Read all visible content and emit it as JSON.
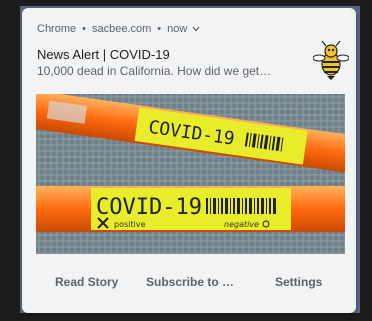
{
  "notification": {
    "app_name": "Chrome",
    "site": "sacbee.com",
    "time": "now",
    "separator": "•",
    "expand_icon": "chevron-down-icon",
    "title": "News Alert | COVID-19",
    "message": "10,000 dead in California. How did we get…",
    "logo_icon": "hornet-mascot-icon",
    "image": {
      "tube_label": "COVID-19",
      "positive_label": "positive",
      "negative_label": "negative"
    },
    "actions": {
      "read_story": "Read Story",
      "subscribe": "Subscribe to …",
      "settings": "Settings"
    }
  },
  "colors": {
    "card_bg": "#f1f3f4",
    "desktop_bg": "#5b6780",
    "tube_orange": "#ff7a1a",
    "label_yellow": "#e8ec2a"
  }
}
